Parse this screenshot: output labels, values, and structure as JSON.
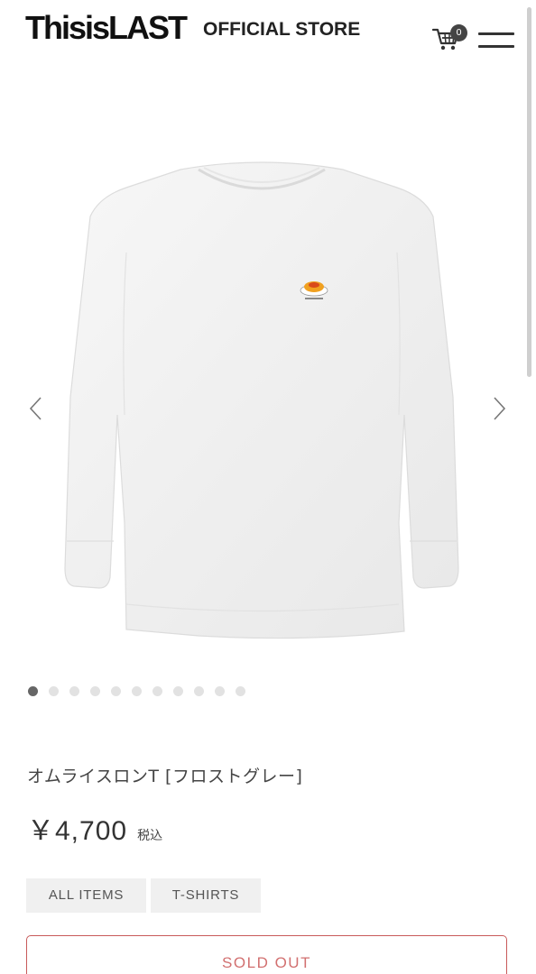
{
  "header": {
    "logo_text": "ThisisLAST",
    "store_label": "OFFICIAL STORE",
    "cart_count": "0"
  },
  "carousel": {
    "slide_count": 11,
    "active_index": 0
  },
  "product": {
    "name": "オムライスロンT [フロストグレー]",
    "price": "￥4,700",
    "tax_label": "税込",
    "tags": [
      "ALL ITEMS",
      "T-SHIRTS"
    ],
    "status_button": "SOLD OUT"
  },
  "colors": {
    "sold_out_border": "#c85a5a",
    "tag_bg": "#f0f0f0",
    "dot_active": "#666666",
    "dot_inactive": "#e2e2e2"
  },
  "icons": {
    "cart": "cart-icon",
    "menu": "hamburger-menu-icon",
    "prev": "chevron-left-icon",
    "next": "chevron-right-icon"
  }
}
